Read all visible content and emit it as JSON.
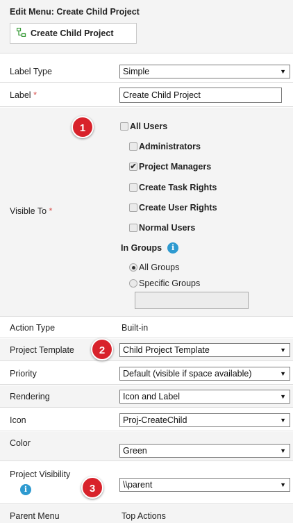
{
  "header": {
    "title": "Edit Menu: Create Child Project",
    "button_label": "Create Child Project",
    "icon": "create-child-project-icon"
  },
  "required_marker": "*",
  "label_type": {
    "label": "Label Type",
    "value": "Simple"
  },
  "label_field": {
    "label": "Label",
    "value": "Create Child Project"
  },
  "visible_to": {
    "label": "Visible To",
    "options": [
      {
        "label": "All Users",
        "checked": false
      },
      {
        "label": "Administrators",
        "checked": false
      },
      {
        "label": "Project Managers",
        "checked": true
      },
      {
        "label": "Create Task Rights",
        "checked": false
      },
      {
        "label": "Create User Rights",
        "checked": false
      },
      {
        "label": "Normal Users",
        "checked": false
      }
    ],
    "in_groups_label": "In Groups",
    "group_options": [
      {
        "label": "All Groups",
        "selected": true
      },
      {
        "label": "Specific Groups",
        "selected": false
      }
    ],
    "specific_groups_value": ""
  },
  "action_type": {
    "label": "Action Type",
    "value": "Built-in"
  },
  "project_template": {
    "label": "Project Template",
    "value": "Child Project Template"
  },
  "priority": {
    "label": "Priority",
    "value": "Default (visible if space available)"
  },
  "rendering": {
    "label": "Rendering",
    "value": "Icon and Label"
  },
  "icon_field": {
    "label": "Icon",
    "value": "Proj-CreateChild"
  },
  "color_field": {
    "label": "Color",
    "value": "Green"
  },
  "project_visibility": {
    "label": "Project Visibility",
    "value": "\\\\parent"
  },
  "parent_menu": {
    "label": "Parent Menu",
    "value": "Top Actions"
  },
  "callouts": [
    "1",
    "2",
    "3"
  ],
  "info_glyph": "i",
  "dropdown_arrow": "▼",
  "colors": {
    "callout": "#d8222b",
    "info": "#2e9ad0",
    "required": "#d9534f",
    "icon_green": "#3a9b3a"
  }
}
